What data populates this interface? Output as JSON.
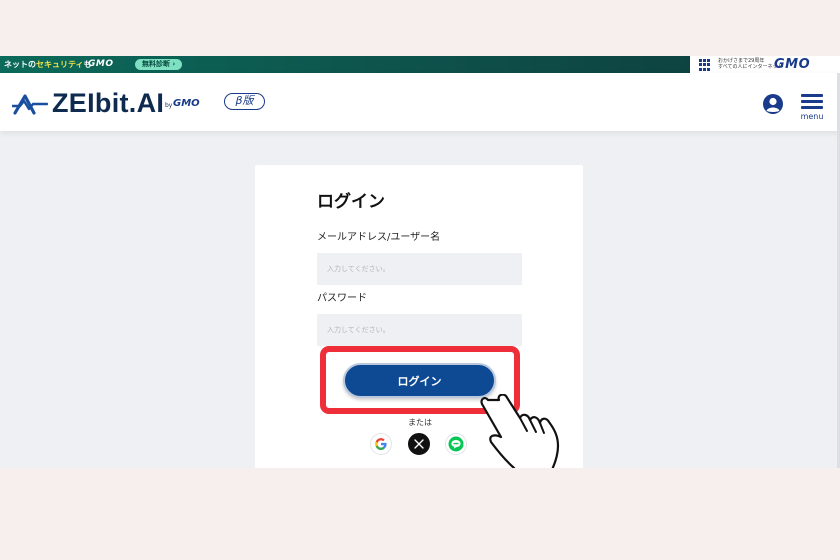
{
  "gmo_bar": {
    "left_message_prefix": "ネットの",
    "left_message_highlight": "セキュリティ",
    "left_message_suffix": "も",
    "left_brand": "GMO",
    "pill_label": "無料診断 ›",
    "right_tagline_line1": "おかげさまで29周年",
    "right_tagline_line2": "すべての人にインターネット",
    "right_brand": "GMO"
  },
  "header": {
    "logo_text": "ZEIbit.AI",
    "logo_by": "by",
    "logo_gmo": "GMO",
    "beta_badge": "β版",
    "menu_label": "menu"
  },
  "login": {
    "title": "ログイン",
    "email_label": "メールアドレス/ユーザー名",
    "email_placeholder": "入力してください。",
    "email_value": "",
    "password_label": "パスワード",
    "password_placeholder": "入力してください。",
    "password_value": "",
    "submit_label": "ログイン",
    "or_text": "または",
    "social_providers": [
      "google",
      "x",
      "line"
    ]
  },
  "colors": {
    "brand_navy": "#0f2a4f",
    "button_blue": "#0e4a94",
    "highlight_red": "#ee2f3a",
    "gmo_green": "#0b6a5a",
    "page_bg": "#eef0f3"
  },
  "icons": [
    "zeibit-logo-mark",
    "grid-icon",
    "user-icon",
    "menu-icon",
    "google-icon",
    "x-icon",
    "line-icon",
    "pointing-hand-icon"
  ]
}
